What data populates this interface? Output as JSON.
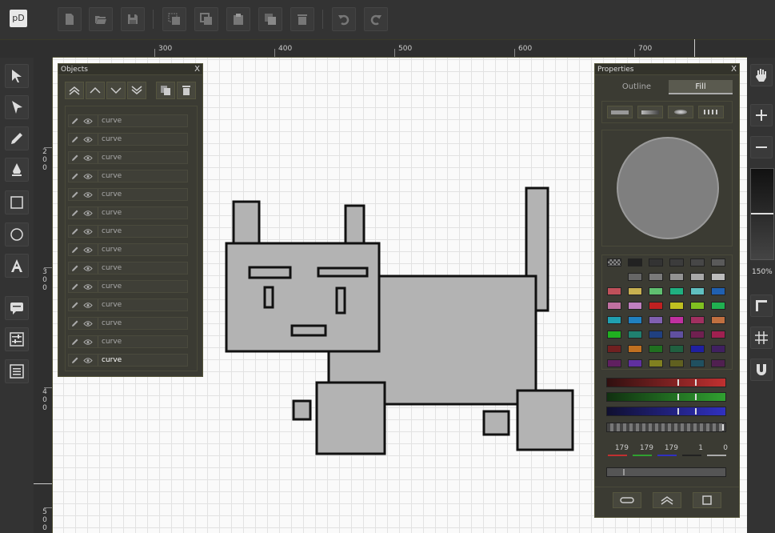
{
  "app": {
    "logo": "pD"
  },
  "ruler": {
    "h_labels": [
      "300",
      "400",
      "500",
      "600",
      "700"
    ],
    "v_labels": [
      "2\n0\n0",
      "3\n0\n0",
      "4\n0\n0",
      "5\n0\n0"
    ]
  },
  "objects_panel": {
    "title": "Objects",
    "close": "X",
    "items": [
      "curve",
      "curve",
      "curve",
      "curve",
      "curve",
      "curve",
      "curve",
      "curve",
      "curve",
      "curve",
      "curve",
      "curve",
      "curve",
      "curve"
    ]
  },
  "properties_panel": {
    "title": "Properties",
    "close": "X",
    "tabs": [
      "Outline",
      "Fill"
    ],
    "active_tab": "Fill",
    "color_values": {
      "r": "179",
      "g": "179",
      "b": "179",
      "a": "1",
      "extra": "0"
    }
  },
  "zoom": {
    "label": "150%"
  },
  "colors": {
    "fill": "#b3b3b3",
    "palette": [
      [
        "#222222",
        "#333333",
        "#3c3c3c",
        "#474747",
        "#5a5a5a"
      ],
      [
        "#666666",
        "#7a7a7a",
        "#929292",
        "#a8a8a8",
        "#bcbcbc"
      ],
      [
        "#c0505a",
        "#c8b050",
        "#60c070",
        "#20b080",
        "#60c0c0",
        "#2060b0"
      ],
      [
        "#c070a0",
        "#c080c0",
        "#c02020",
        "#c0c020",
        "#80c020",
        "#20b050"
      ],
      [
        "#20a0b0",
        "#2080c0",
        "#8060b0",
        "#c030a0",
        "#a03060",
        "#c07040"
      ],
      [
        "#20b020",
        "#208070",
        "#204080",
        "#6050a0",
        "#702050",
        "#a02050"
      ],
      [
        "#702020",
        "#c07020",
        "#207020",
        "#206040",
        "#2020a0",
        "#402060"
      ],
      [
        "#602060",
        "#6030a0",
        "#808020",
        "#606020",
        "#205060",
        "#502050"
      ]
    ]
  },
  "icons": {
    "toolbar": [
      "new-file-icon",
      "open-folder-icon",
      "save-icon",
      "copy-icon",
      "duplicate-icon",
      "paste-icon",
      "clone-icon",
      "trash-icon",
      "undo-icon",
      "redo-icon"
    ],
    "left_tools": [
      "select-arrow-icon",
      "direct-select-icon",
      "pencil-icon",
      "pen-icon",
      "rectangle-icon",
      "ellipse-icon",
      "text-icon",
      "comment-icon",
      "sliders-icon",
      "list-icon"
    ],
    "right_tools": [
      "hand-icon",
      "zoom-in-icon",
      "zoom-out-icon",
      "ruler-icon",
      "grid-icon",
      "magnet-icon"
    ]
  }
}
